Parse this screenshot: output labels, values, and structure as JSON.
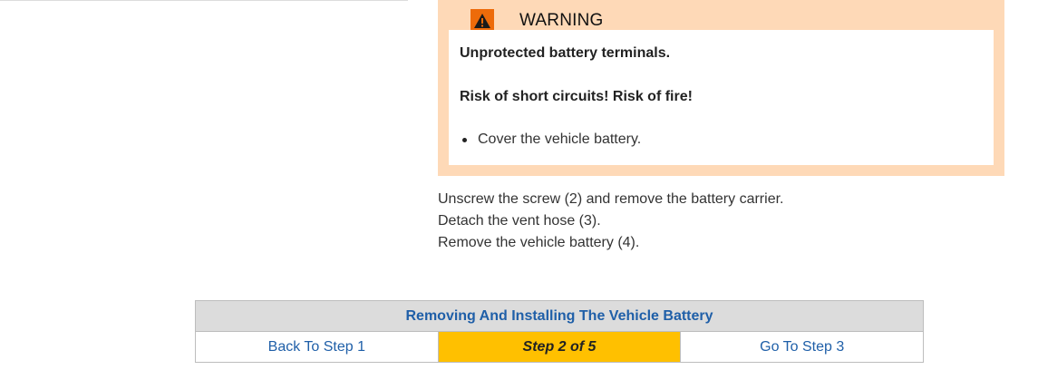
{
  "warning": {
    "icon": "warning-triangle-icon",
    "title": "WARNING",
    "hazard": "Unprotected battery terminals.",
    "risk": "Risk of short circuits! Risk of fire!",
    "measures": [
      "Cover the vehicle battery."
    ]
  },
  "instructions": [
    "Unscrew the screw (2) and remove the battery carrier.",
    "Detach the vent hose (3).",
    "Remove the vehicle battery (4)."
  ],
  "navigation": {
    "title": "Removing And Installing The Vehicle Battery",
    "back_label": "Back To Step 1",
    "current_label": "Step 2 of 5",
    "next_label": "Go To Step 3"
  },
  "colors": {
    "warning_background": "#fed9b7",
    "warning_icon": "#ed6b0a",
    "current_step": "#ffc000",
    "link": "#1f5fa8"
  }
}
